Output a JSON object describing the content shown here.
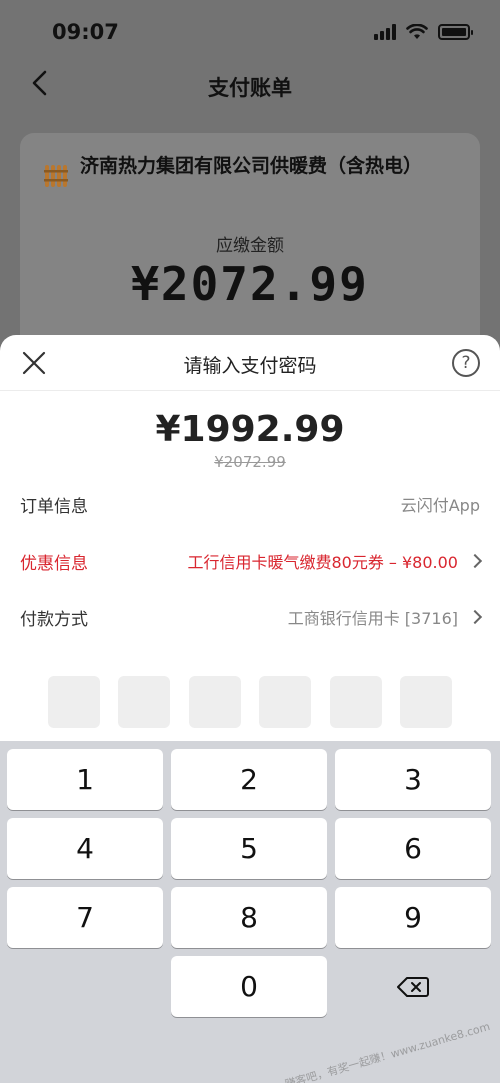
{
  "status_bar": {
    "time": "09:07",
    "icons": [
      "signal-icon",
      "wifi-icon",
      "battery-icon"
    ]
  },
  "nav": {
    "title": "支付账单",
    "back_icon": "chevron-left-icon"
  },
  "bill": {
    "logo_icon": "heating-logo-icon",
    "merchant": "济南热力集团有限公司供暖费（含热电）",
    "due_label": "应缴金额",
    "due_amount": "¥2072.99"
  },
  "sheet": {
    "title": "请输入支付密码",
    "close_icon": "close-icon",
    "help_label": "?",
    "pay_amount": "¥1992.99",
    "original_amount": "¥2072.99",
    "rows": [
      {
        "label": "订单信息",
        "value": "云闪付App"
      },
      {
        "label": "优惠信息",
        "value": "工行信用卡暖气缴费80元券 – ¥80.00"
      },
      {
        "label": "付款方式",
        "value": "工商银行信用卡 [3716]"
      }
    ],
    "pin_length": 6
  },
  "keypad": {
    "keys": [
      "1",
      "2",
      "3",
      "4",
      "5",
      "6",
      "7",
      "8",
      "9",
      "",
      "0",
      "⌫"
    ]
  },
  "watermark": "赚客吧，有奖一起赚！www.zuanke8.com",
  "colors": {
    "discount_red": "#d9262f",
    "dim_overlay": "#737373"
  }
}
